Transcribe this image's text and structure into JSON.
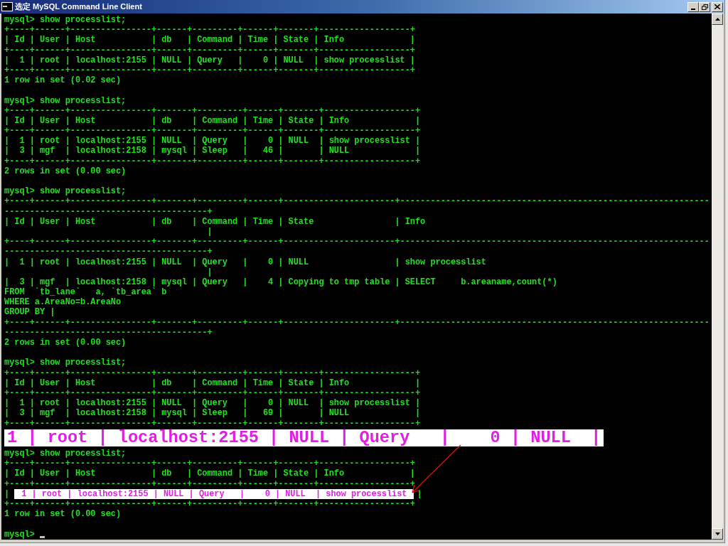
{
  "window": {
    "title": "选定 MySQL Command Line Client"
  },
  "console": {
    "lines": [
      {
        "kind": "text",
        "text": "mysql> show processlist;"
      },
      {
        "kind": "text",
        "text": "+----+------+----------------+------+---------+------+-------+------------------+"
      },
      {
        "kind": "text",
        "text": "| Id | User | Host           | db   | Command | Time | State | Info             |"
      },
      {
        "kind": "text",
        "text": "+----+------+----------------+------+---------+------+-------+------------------+"
      },
      {
        "kind": "text",
        "text": "|  1 | root | localhost:2155 | NULL | Query   |    0 | NULL  | show processlist |"
      },
      {
        "kind": "text",
        "text": "+----+------+----------------+------+---------+------+-------+------------------+"
      },
      {
        "kind": "text",
        "text": "1 row in set (0.02 sec)"
      },
      {
        "kind": "blank"
      },
      {
        "kind": "text",
        "text": "mysql> show processlist;"
      },
      {
        "kind": "text",
        "text": "+----+------+----------------+-------+---------+------+-------+------------------+"
      },
      {
        "kind": "text",
        "text": "| Id | User | Host           | db    | Command | Time | State | Info             |"
      },
      {
        "kind": "text",
        "text": "+----+------+----------------+-------+---------+------+-------+------------------+"
      },
      {
        "kind": "text",
        "text": "|  1 | root | localhost:2155 | NULL  | Query   |    0 | NULL  | show processlist |"
      },
      {
        "kind": "text",
        "text": "|  3 | mgf  | localhost:2158 | mysql | Sleep   |   46 |       | NULL             |"
      },
      {
        "kind": "text",
        "text": "+----+------+----------------+-------+---------+------+-------+------------------+"
      },
      {
        "kind": "text",
        "text": "2 rows in set (0.00 sec)"
      },
      {
        "kind": "blank"
      },
      {
        "kind": "text",
        "text": "mysql> show processlist;"
      },
      {
        "kind": "text",
        "text": "+----+------+----------------+-------+---------+------+----------------------+-------------------------------------------------------------"
      },
      {
        "kind": "text",
        "text": "----------------------------------------+"
      },
      {
        "kind": "text",
        "text": "| Id | User | Host           | db    | Command | Time | State                | Info"
      },
      {
        "kind": "text",
        "text": "                                        |"
      },
      {
        "kind": "text",
        "text": "+----+------+----------------+-------+---------+------+----------------------+-------------------------------------------------------------"
      },
      {
        "kind": "text",
        "text": "----------------------------------------+"
      },
      {
        "kind": "text",
        "text": "|  1 | root | localhost:2155 | NULL  | Query   |    0 | NULL                 | show processlist"
      },
      {
        "kind": "text",
        "text": "                                        |"
      },
      {
        "kind": "text",
        "text": "|  3 | mgf  | localhost:2158 | mysql | Query   |    4 | Copying to tmp table | SELECT     b.areaname,count(*)"
      },
      {
        "kind": "text",
        "text": "FROM  `tb_lane`   a, `tb_area` b"
      },
      {
        "kind": "text",
        "text": "WHERE a.AreaNo=b.AreaNo"
      },
      {
        "kind": "text",
        "text": "GROUP BY |"
      },
      {
        "kind": "text",
        "text": "+----+------+----------------+-------+---------+------+----------------------+-------------------------------------------------------------"
      },
      {
        "kind": "text",
        "text": "----------------------------------------+"
      },
      {
        "kind": "text",
        "text": "2 rows in set (0.00 sec)"
      },
      {
        "kind": "blank"
      },
      {
        "kind": "text",
        "text": "mysql> show processlist;"
      },
      {
        "kind": "text",
        "text": "+----+------+----------------+-------+---------+------+-------+------------------+"
      },
      {
        "kind": "text",
        "text": "| Id | User | Host           | db    | Command | Time | State | Info             |"
      },
      {
        "kind": "text",
        "text": "+----+------+----------------+-------+---------+------+-------+------------------+"
      },
      {
        "kind": "text",
        "text": "|  1 | root | localhost:2155 | NULL  | Query   |    0 | NULL  | show processlist |"
      },
      {
        "kind": "text",
        "text": "|  3 | mgf  | localhost:2158 | mysql | Sleep   |   69 |       | NULL             |"
      },
      {
        "kind": "text",
        "text": "+----+------+----------------+-------+---------+------+-------+------------------+"
      },
      {
        "kind": "callout",
        "text": "1 | root | localhost:2155 | NULL | Query   |    0 | NULL  |"
      },
      {
        "kind": "text",
        "text": "mysql> show processlist;"
      },
      {
        "kind": "text",
        "text": "+----+------+----------------+------+---------+------+-------+------------------+"
      },
      {
        "kind": "text",
        "text": "| Id | User | Host           | db   | Command | Time | State | Info             |"
      },
      {
        "kind": "text",
        "text": "+----+------+----------------+------+---------+------+-------+------------------+"
      },
      {
        "kind": "highlight",
        "prefix": "|",
        "text": "1 | root | localhost:2155 | NULL | Query   |    0 | NULL  | show processlist",
        "suffix": "|"
      },
      {
        "kind": "text",
        "text": "+----+------+----------------+------+---------+------+-------+------------------+"
      },
      {
        "kind": "text",
        "text": "1 row in set (0.00 sec)"
      },
      {
        "kind": "blank"
      },
      {
        "kind": "cursor",
        "text": "mysql>"
      }
    ]
  }
}
